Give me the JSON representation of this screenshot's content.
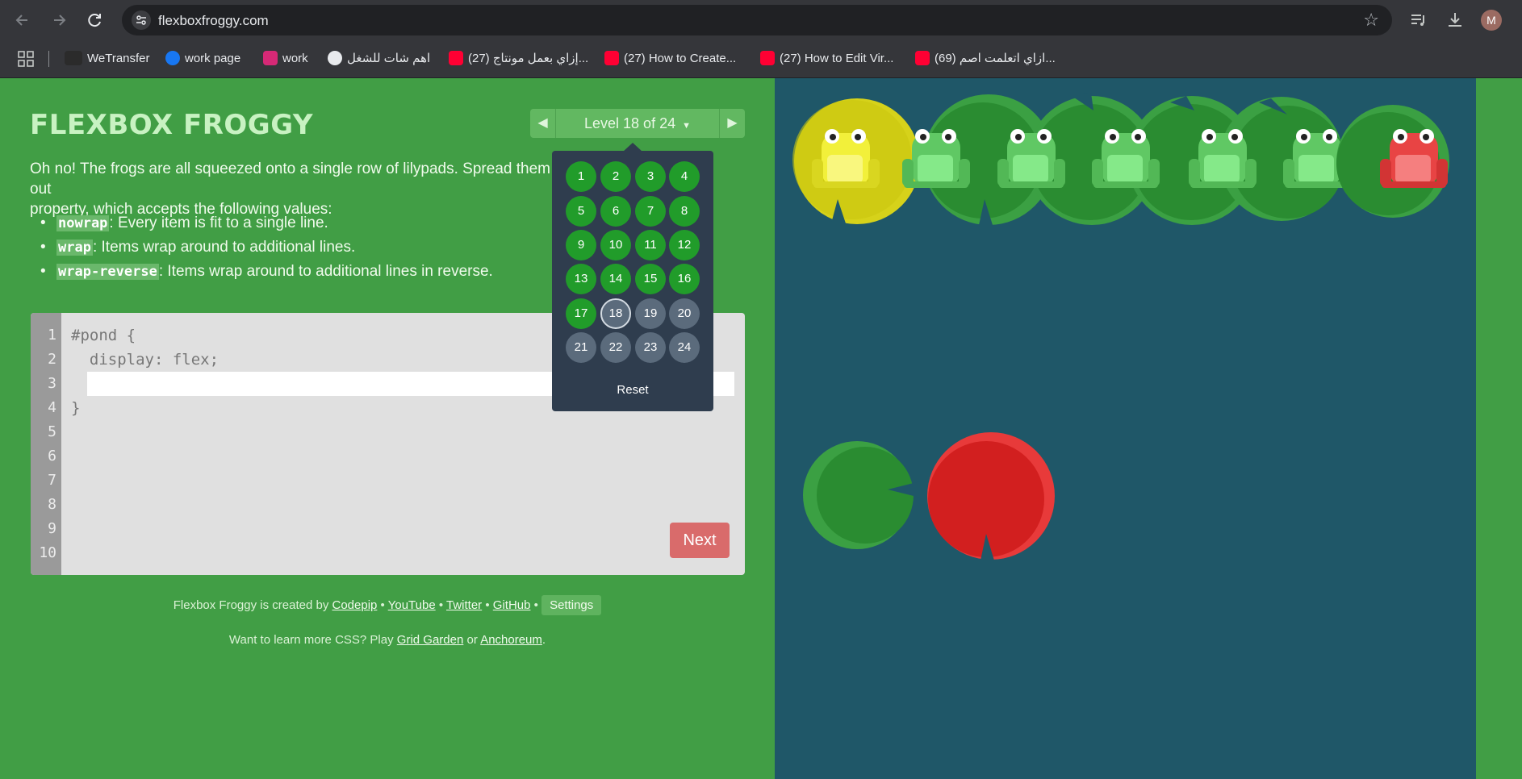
{
  "browser": {
    "url": "flexboxfroggy.com",
    "profile_initial": "M",
    "bookmarks": [
      {
        "label": "WeTransfer"
      },
      {
        "label": "work page"
      },
      {
        "label": "work"
      },
      {
        "label": "اهم شات للشغل"
      },
      {
        "label": "(27) إزاي بعمل مونتاج..."
      },
      {
        "label": "(27) How to Create..."
      },
      {
        "label": "(27) How to Edit Vir..."
      },
      {
        "label": "(69) ازاي اتعلمت اصم..."
      }
    ]
  },
  "game": {
    "title": "FLEXBOX FROGGY",
    "level_label": "Level 18 of 24",
    "instructions": "Oh no! The frogs are all squeezed onto a single row of lilypads. Spread them out using the flex-wrap property, which accepts the following values:",
    "instructions_line1": "Oh no! The frogs are all squeezed onto a single row of lilypads. Spread them out",
    "instructions_line2": "property, which accepts the following values:",
    "values": [
      {
        "keyword": "nowrap",
        "desc": ": Every item is fit to a single line."
      },
      {
        "keyword": "wrap",
        "desc": ": Items wrap around to additional lines."
      },
      {
        "keyword": "wrap-reverse",
        "desc": ": Items wrap around to additional lines in reverse."
      }
    ],
    "code": {
      "line1": "#pond {",
      "line2": "  display: flex;",
      "line4": "}",
      "input_value": "",
      "line_numbers": [
        "1",
        "2",
        "3",
        "4",
        "5",
        "6",
        "7",
        "8",
        "9",
        "10"
      ]
    },
    "next_label": "Next",
    "credits": {
      "prefix": "Flexbox Froggy is created by",
      "links": [
        "Codepip",
        "YouTube",
        "Twitter",
        "GitHub"
      ],
      "settings_label": "Settings"
    },
    "learn_more": {
      "prefix": "Want to learn more CSS? Play",
      "link1": "Grid Garden",
      "middle": "or",
      "link2": "Anchoreum",
      "suffix": "."
    },
    "level_menu": {
      "levels": [
        "1",
        "2",
        "3",
        "4",
        "5",
        "6",
        "7",
        "8",
        "9",
        "10",
        "11",
        "12",
        "13",
        "14",
        "15",
        "16",
        "17",
        "18",
        "19",
        "20",
        "21",
        "22",
        "23",
        "24"
      ],
      "completed_through": 17,
      "current": 18,
      "reset_label": "Reset"
    }
  },
  "pond": {
    "frogs": [
      "yellow",
      "green",
      "green",
      "green",
      "green",
      "green",
      "red"
    ],
    "lilypads_visible_targets": [
      "green",
      "red"
    ],
    "colors": {
      "green": "#219c2a",
      "yellow": "#e3e01b",
      "red": "#e02d2d",
      "water": "#1f5768"
    }
  }
}
